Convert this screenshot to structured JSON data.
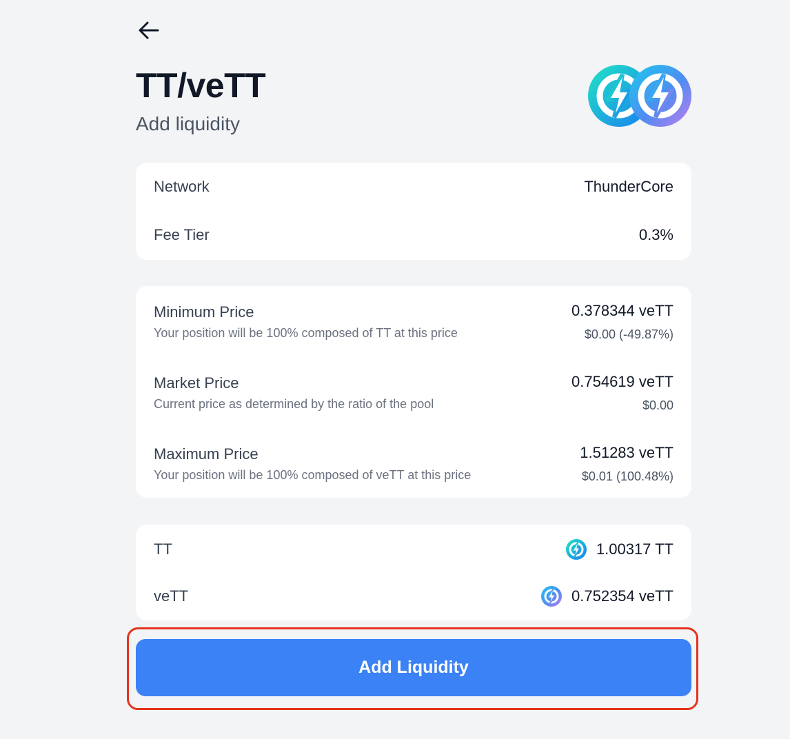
{
  "header": {
    "title": "TT/veTT",
    "subtitle": "Add liquidity"
  },
  "details": {
    "network_label": "Network",
    "network_value": "ThunderCore",
    "fee_label": "Fee Tier",
    "fee_value": "0.3%"
  },
  "prices": [
    {
      "label": "Minimum Price",
      "description": "Your position will be 100% composed of TT at this price",
      "value": "0.378344 veTT",
      "usd": "$0.00 (-49.87%)"
    },
    {
      "label": "Market Price",
      "description": "Current price as determined by the ratio of the pool",
      "value": "0.754619 veTT",
      "usd": "$0.00"
    },
    {
      "label": "Maximum Price",
      "description": "Your position will be 100% composed of veTT at this price",
      "value": "1.51283 veTT",
      "usd": "$0.01 (100.48%)"
    }
  ],
  "amounts": [
    {
      "token": "TT",
      "value": "1.00317 TT",
      "icon": "tt-token-icon"
    },
    {
      "token": "veTT",
      "value": "0.752354 veTT",
      "icon": "vett-token-icon"
    }
  ],
  "actions": {
    "add_liquidity_label": "Add Liquidity"
  },
  "colors": {
    "accent": "#3b82f6",
    "highlight": "#e5321f",
    "background": "#f3f4f6"
  }
}
